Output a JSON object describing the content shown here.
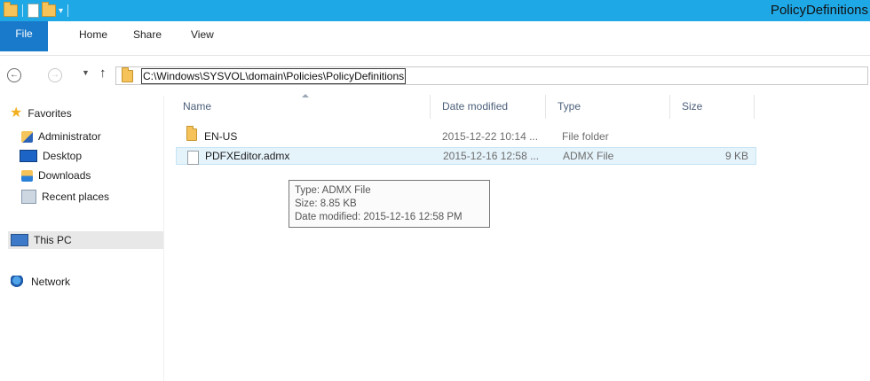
{
  "window": {
    "title": "PolicyDefinitions"
  },
  "ribbon": {
    "tabs": [
      {
        "label": "File"
      },
      {
        "label": "Home"
      },
      {
        "label": "Share"
      },
      {
        "label": "View"
      }
    ]
  },
  "address": {
    "path": "C:\\Windows\\SYSVOL\\domain\\Policies\\PolicyDefinitions"
  },
  "nav": {
    "favorites": {
      "label": "Favorites",
      "items": [
        {
          "label": "Administrator",
          "icon": "administrator-folder-icon"
        },
        {
          "label": "Desktop",
          "icon": "desktop-icon"
        },
        {
          "label": "Downloads",
          "icon": "downloads-icon"
        },
        {
          "label": "Recent places",
          "icon": "recent-places-icon"
        }
      ]
    },
    "this_pc": {
      "label": "This PC",
      "selected": true
    },
    "network": {
      "label": "Network"
    }
  },
  "file_list": {
    "columns": [
      "Name",
      "Date modified",
      "Type",
      "Size"
    ],
    "rows": [
      {
        "name": "EN-US",
        "date": "2015-12-22 10:14 ...",
        "type": "File folder",
        "size": "",
        "icon": "folder-icon"
      },
      {
        "name": "PDFXEditor.admx",
        "date": "2015-12-16 12:58 ...",
        "type": "ADMX File",
        "size": "9 KB",
        "icon": "file-icon",
        "hover": true
      }
    ]
  },
  "tooltip": {
    "type": "Type: ADMX File",
    "size": "Size: 8.85 KB",
    "date": "Date modified: 2015-12-16 12:58 PM"
  },
  "colors": {
    "titlebar": "#1fa8e6",
    "file_tab": "#1979ca",
    "hover_row": "#e5f3fb",
    "selected_nav": "#e8e8e8"
  }
}
